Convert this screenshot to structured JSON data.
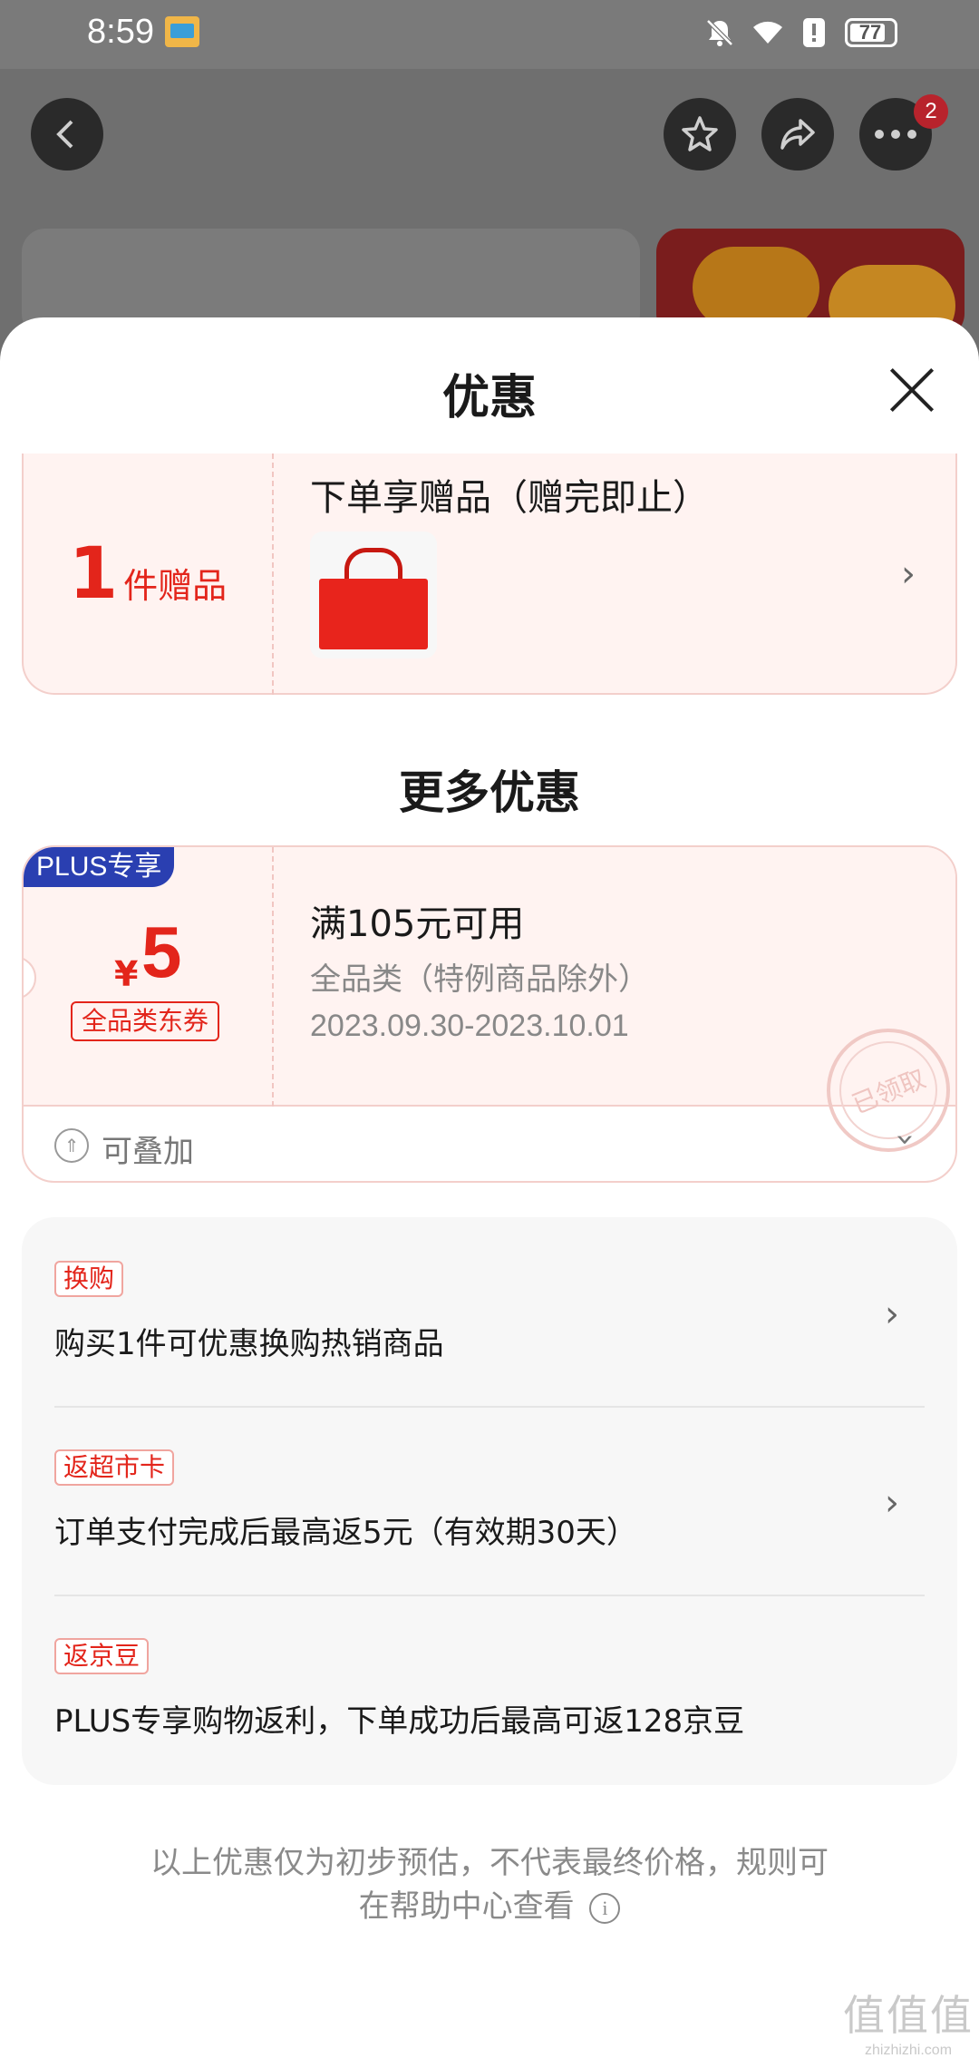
{
  "status_bar": {
    "time": "8:59",
    "battery": "77"
  },
  "nav": {
    "more_badge": "2"
  },
  "sheet": {
    "title": "优惠",
    "gift": {
      "count": "1",
      "unit": "件赠品",
      "title": "下单享赠品（赠完即止）"
    },
    "more_title": "更多优惠",
    "coupon": {
      "plus_tag": "PLUS专享",
      "currency": "¥",
      "amount": "5",
      "kind": "全品类东券",
      "condition": "满105元可用",
      "scope": "全品类（特例商品除外）",
      "period": "2023.09.30-2023.10.01",
      "stamp": "已领取",
      "stack_label": "可叠加"
    },
    "promotions": [
      {
        "tag": "换购",
        "text": "购买1件可优惠换购热销商品"
      },
      {
        "tag": "返超市卡",
        "text": "订单支付完成后最高返5元（有效期30天）"
      },
      {
        "tag": "返京豆",
        "text": "PLUS专享购物返利，下单成功后最高可返128京豆"
      }
    ],
    "footer_line1": "以上优惠仅为初步预估，不代表最终价格，规则可",
    "footer_line2": "在帮助中心查看"
  },
  "watermark": {
    "big": "值值值",
    "small": "zhizhizhi.com"
  },
  "colors": {
    "accent_red": "#e3251b",
    "plus_blue": "#2a3fb1",
    "card_pink": "#fff3f1"
  }
}
